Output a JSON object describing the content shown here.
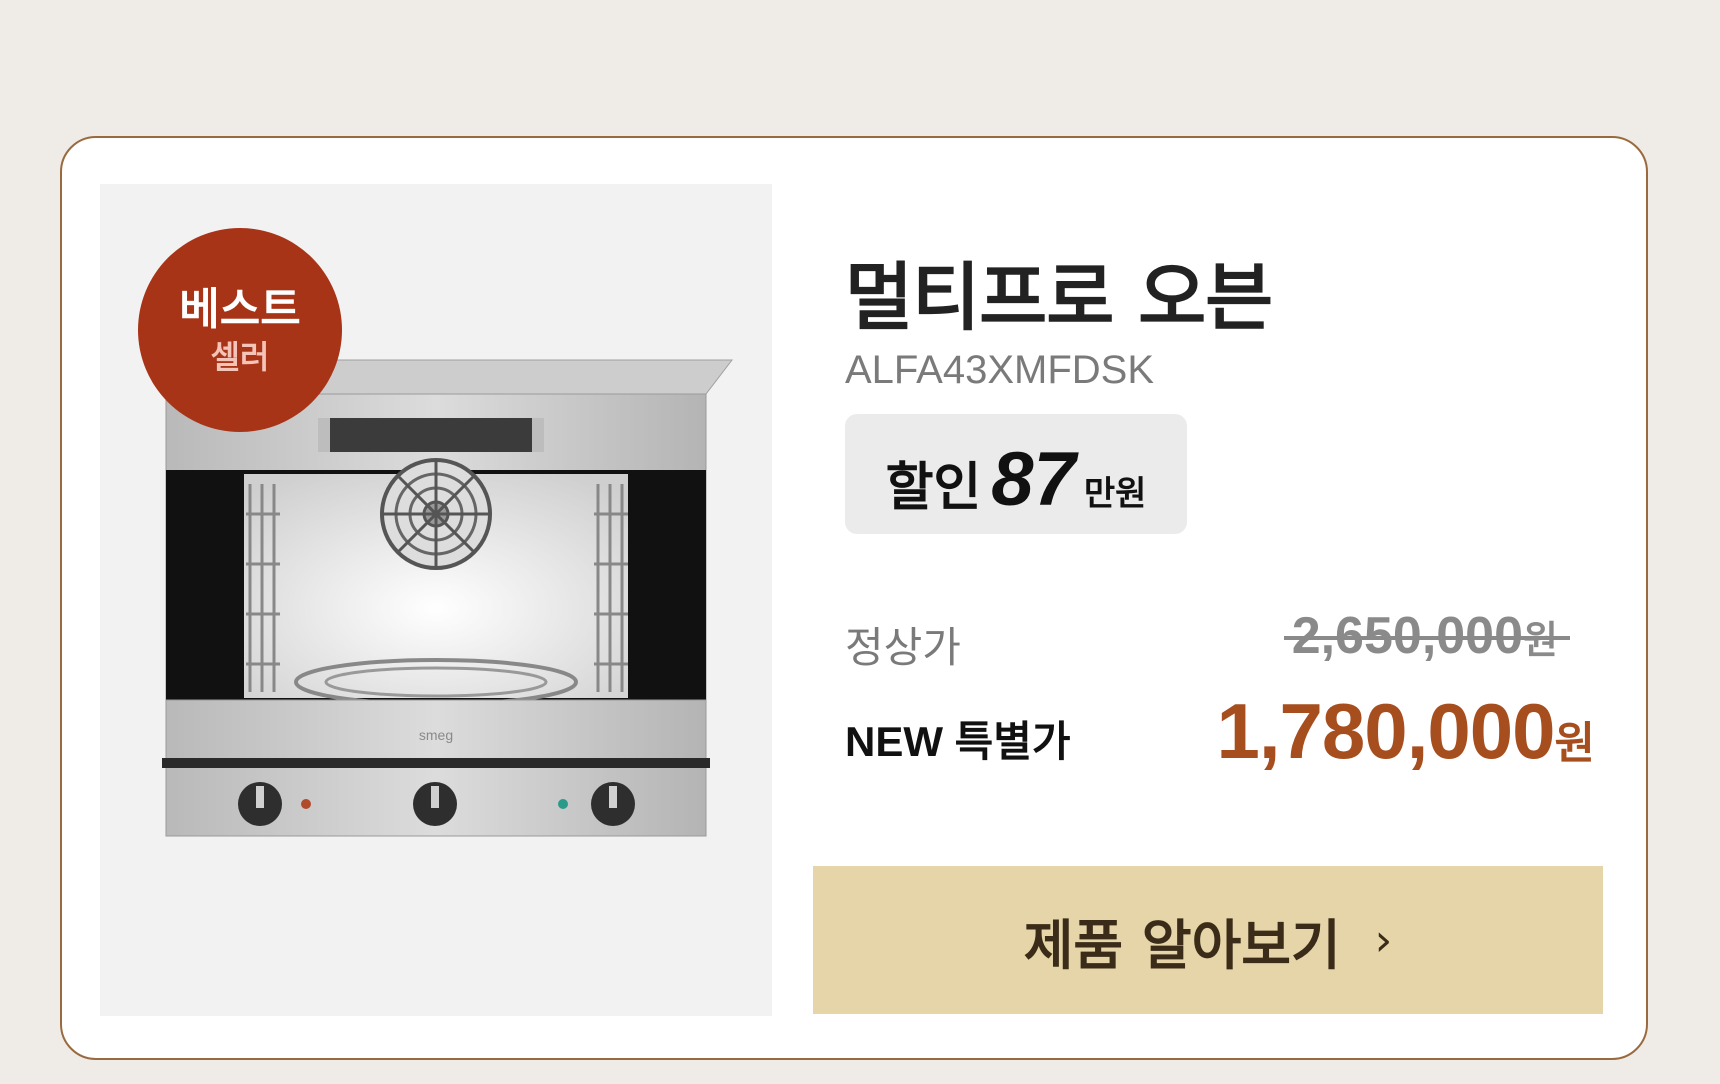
{
  "badge": {
    "line1": "베스트",
    "line2": "셀러"
  },
  "product": {
    "name": "멀티프로 오븐",
    "model": "ALFA43XMFDSK",
    "image_brand": "smeg"
  },
  "discount": {
    "label": "할인",
    "amount": "87",
    "unit": "만원"
  },
  "prices": {
    "regular_label": "정상가",
    "regular_value": "2,650,000",
    "regular_unit": "원",
    "special_label": "NEW 특별가",
    "special_value": "1,780,000",
    "special_unit": "원"
  },
  "cta": {
    "label": "제품 알아보기",
    "arrow": "›"
  },
  "colors": {
    "accent_price": "#a74e1e",
    "badge": "#a83418",
    "button": "#e6d5a8",
    "card_border": "#9a6a3e"
  }
}
